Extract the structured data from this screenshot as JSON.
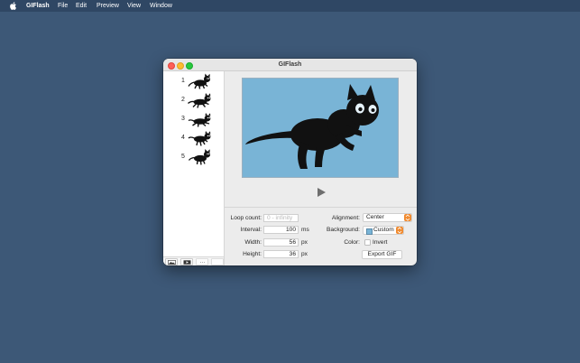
{
  "menubar": {
    "apple_icon": "apple-logo-icon",
    "app_name": "GIFlash",
    "items": [
      "File",
      "Edit",
      "Preview",
      "View",
      "Window"
    ]
  },
  "window": {
    "title": "GIFlash"
  },
  "sidebar": {
    "frames": [
      {
        "number": "1"
      },
      {
        "number": "2"
      },
      {
        "number": "3"
      },
      {
        "number": "4"
      },
      {
        "number": "5"
      }
    ],
    "bottom_buttons": [
      "add-image-icon",
      "add-video-icon",
      "more-icon",
      "empty-slot"
    ]
  },
  "preview": {
    "background_color": "#79b4d6",
    "play_icon": "play-icon"
  },
  "settings": {
    "loop_count": {
      "label": "Loop count:",
      "placeholder": "0 - infinity",
      "value": ""
    },
    "interval": {
      "label": "Interval:",
      "value": "100",
      "unit": "ms"
    },
    "width": {
      "label": "Width:",
      "value": "56",
      "unit": "px"
    },
    "height": {
      "label": "Height:",
      "value": "36",
      "unit": "px"
    },
    "alignment": {
      "label": "Alignment:",
      "value": "Center"
    },
    "background": {
      "label": "Background:",
      "value": "Custom",
      "swatch_color": "#79b4d6"
    },
    "color": {
      "label": "Color:",
      "checkbox_label": "Invert",
      "checked": false
    },
    "export_label": "Export GIF"
  }
}
